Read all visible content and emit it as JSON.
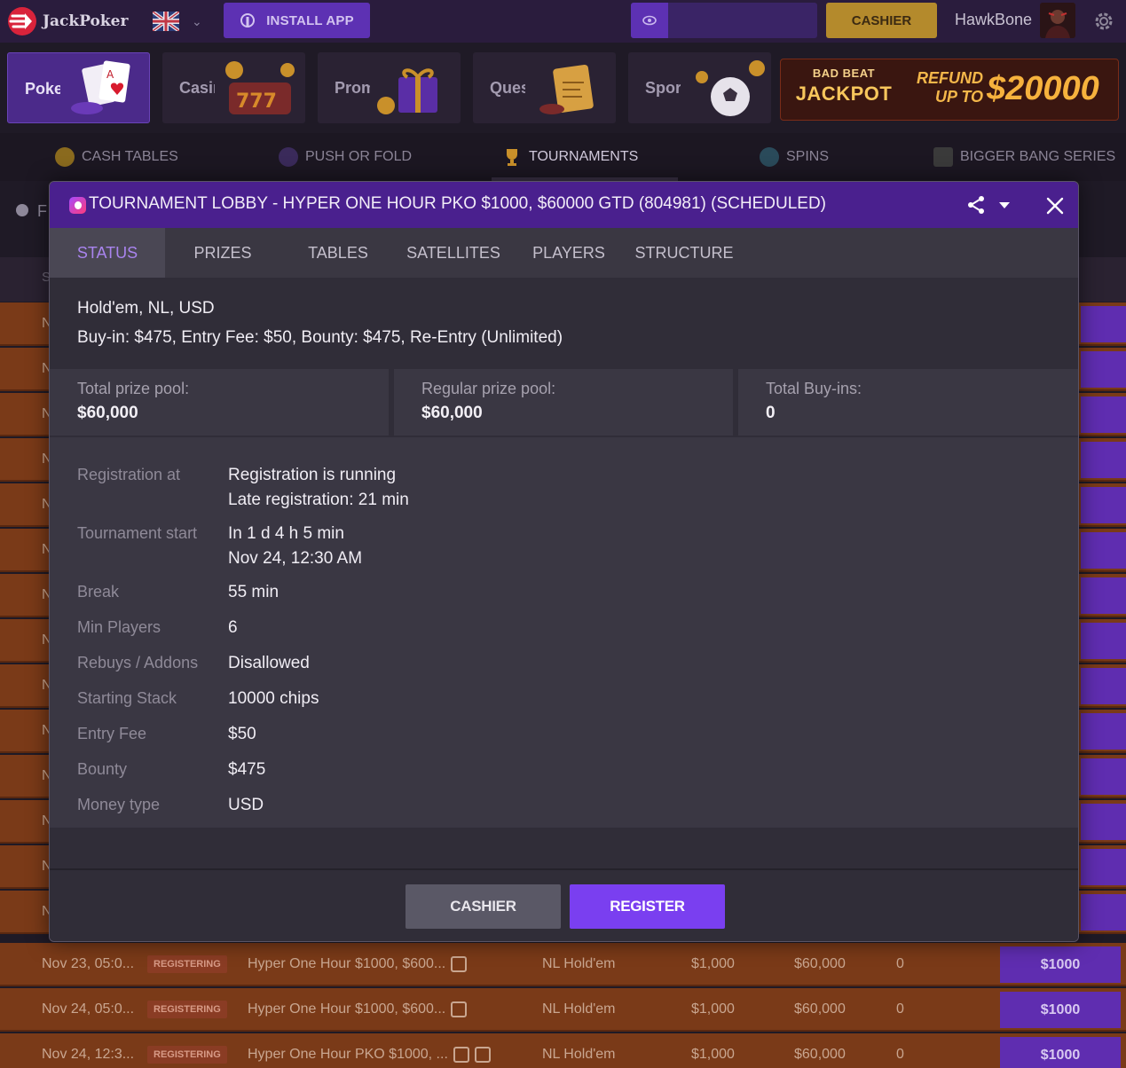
{
  "brand": {
    "name": "JackPoker"
  },
  "topbar": {
    "install_label": "INSTALL APP",
    "cashier_label": "CASHIER",
    "username": "HawkBone",
    "language_flag": "uk-flag-icon"
  },
  "categories": [
    {
      "label": "Poker",
      "active": true
    },
    {
      "label": "Casino",
      "active": false
    },
    {
      "label": "Promo",
      "active": false
    },
    {
      "label": "Quests",
      "active": false
    },
    {
      "label": "Sport",
      "active": false
    }
  ],
  "jackpot": {
    "line1": "BAD BEAT",
    "line2": "JACKPOT",
    "refund": "REFUND UP TO",
    "amount": "$20000"
  },
  "lobby_tabs": [
    {
      "label": "CASH TABLES",
      "active": false
    },
    {
      "label": "PUSH OR FOLD",
      "active": false
    },
    {
      "label": "TOURNAMENTS",
      "active": true
    },
    {
      "label": "SPINS",
      "active": false
    },
    {
      "label": "BIGGER BANG SERIES",
      "active": false
    }
  ],
  "background_list": {
    "filter_letter": "F",
    "header_letter": "S",
    "row_letter": "N",
    "rows": [
      {
        "date": "Nov 23, 05:0...",
        "status": "REGISTERING",
        "name": "Hyper One Hour $1000, $600...",
        "game": "NL Hold'em",
        "buyin": "$1,000",
        "gtd": "$60,000",
        "players": "0",
        "button": "$1000"
      },
      {
        "date": "Nov 24, 05:0...",
        "status": "REGISTERING",
        "name": "Hyper One Hour $1000, $600...",
        "game": "NL Hold'em",
        "buyin": "$1,000",
        "gtd": "$60,000",
        "players": "0",
        "button": "$1000"
      },
      {
        "date": "Nov 24, 12:3...",
        "status": "REGISTERING",
        "name": "Hyper One Hour PKO $1000, ...",
        "game": "NL Hold'em",
        "buyin": "$1,000",
        "gtd": "$60,000",
        "players": "0",
        "button": "$1000"
      }
    ]
  },
  "modal": {
    "title": "TOURNAMENT LOBBY - HYPER ONE HOUR PKO $1000, $60000 GTD (804981) (SCHEDULED)",
    "tabs": [
      {
        "label": "STATUS",
        "active": true
      },
      {
        "label": "PRIZES",
        "active": false
      },
      {
        "label": "TABLES",
        "active": false
      },
      {
        "label": "SATELLITES",
        "active": false
      },
      {
        "label": "PLAYERS",
        "active": false
      },
      {
        "label": "STRUCTURE",
        "active": false
      }
    ],
    "game_line": "Hold'em, NL, USD",
    "buyin_line": "Buy-in: $475, Entry Fee: $50, Bounty: $475, Re-Entry (Unlimited)",
    "pools": [
      {
        "label": "Total prize pool:",
        "value": "$60,000"
      },
      {
        "label": "Regular prize pool:",
        "value": "$60,000"
      },
      {
        "label": "Total Buy-ins:",
        "value": "0"
      }
    ],
    "details": [
      {
        "label": "Registration at",
        "values": [
          "Registration is running",
          "Late registration: 21 min"
        ]
      },
      {
        "label": "Tournament start",
        "values": [
          "In 1 d 4 h 5 min",
          "Nov 24, 12:30 AM"
        ]
      },
      {
        "label": "Break",
        "values": [
          "55 min"
        ]
      },
      {
        "label": "Min Players",
        "values": [
          "6"
        ]
      },
      {
        "label": "Rebuys / Addons",
        "values": [
          "Disallowed"
        ]
      },
      {
        "label": "Starting Stack",
        "values": [
          "10000 chips"
        ]
      },
      {
        "label": "Entry Fee",
        "values": [
          "$50"
        ]
      },
      {
        "label": "Bounty",
        "values": [
          "$475"
        ]
      },
      {
        "label": "Money type",
        "values": [
          "USD"
        ]
      }
    ],
    "cashier_label": "CASHIER",
    "register_label": "REGISTER"
  },
  "colors": {
    "accent": "#7a3ff0",
    "modal_header": "#4a208e",
    "active_tab_text": "#a984ee",
    "cashier_gold": "#b48a2c",
    "row_bg": "#7a3a18"
  }
}
